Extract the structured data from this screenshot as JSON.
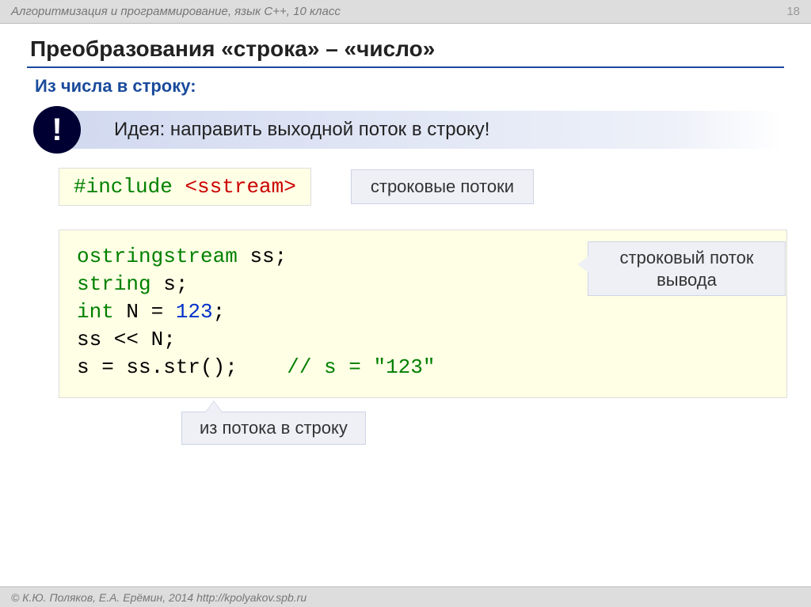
{
  "header": {
    "course_title": "Алгоритмизация и программирование, язык C++, 10 класс",
    "page_number": "18"
  },
  "title": "Преобразования «строка» – «число»",
  "subsection": "Из числа в строку:",
  "idea": {
    "badge": "!",
    "text": "Идея: направить выходной поток в строку!"
  },
  "include_block": {
    "keyword": "#include ",
    "header": "<sstream>",
    "note": "строковые потоки"
  },
  "code": {
    "line1": {
      "a": "ostringstream",
      "b": " ss;"
    },
    "line2": {
      "a": "string",
      "b": " s;"
    },
    "line3": {
      "a": "int",
      "b": " N = ",
      "c": "123",
      "d": ";"
    },
    "line4": "ss << N;",
    "line5": {
      "a": "s = ss.str();    ",
      "b": "// s = \"123\""
    }
  },
  "callouts": {
    "stream": "строковый поток вывода",
    "str": "из потока в строку"
  },
  "footer": {
    "copyright": "© К.Ю. Поляков, Е.А. Ерёмин, 2014   http://kpolyakov.spb.ru"
  }
}
